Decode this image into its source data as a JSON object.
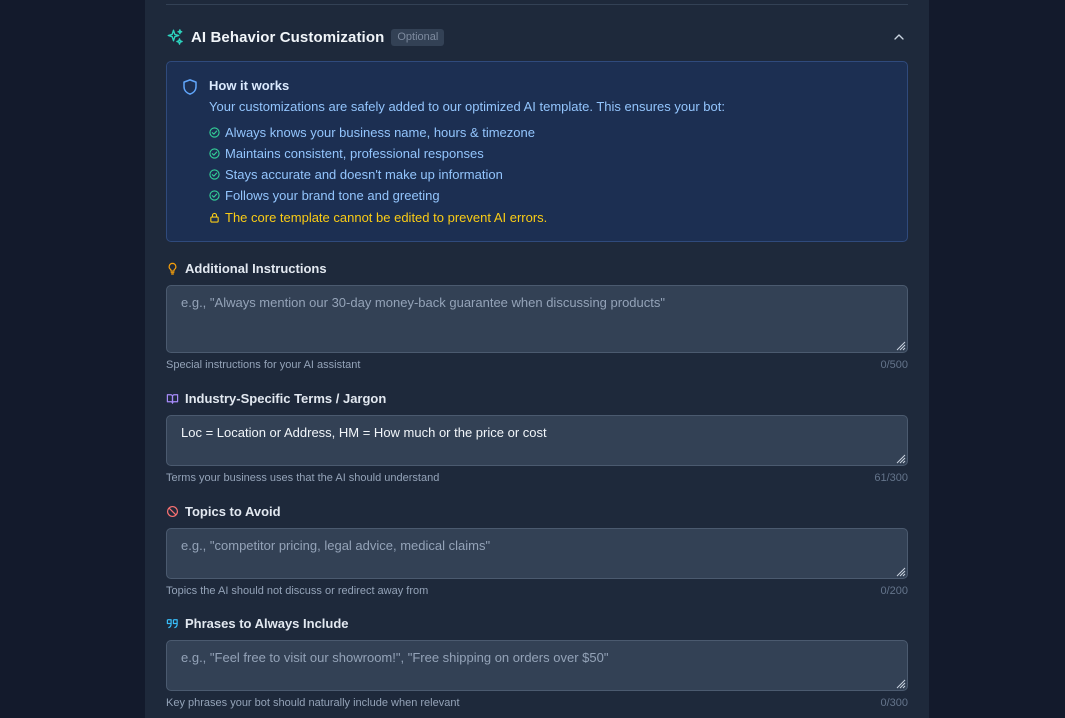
{
  "section": {
    "title": "AI Behavior Customization",
    "badge": "Optional",
    "sparkle_icon": "sparkle-icon",
    "collapse_icon": "chevron-up-icon"
  },
  "info": {
    "title": "How it works",
    "description": "Your customizations are safely added to our optimized AI template. This ensures your bot:",
    "items": [
      "Always knows your business name, hours & timezone",
      "Maintains consistent, professional responses",
      "Stays accurate and doesn't make up information",
      "Follows your brand tone and greeting"
    ],
    "warning": "The core template cannot be edited to prevent AI errors.",
    "colors": {
      "accent": "#60a5fa",
      "check": "#34d399",
      "warning": "#facc15"
    }
  },
  "fields": {
    "instructions": {
      "label": "Additional Instructions",
      "icon": "lightbulb-icon",
      "placeholder": "e.g., \"Always mention our 30-day money-back guarantee when discussing products\"",
      "value": "",
      "help": "Special instructions for your AI assistant",
      "count": "0/500"
    },
    "terms": {
      "label": "Industry-Specific Terms / Jargon",
      "icon": "book-open-icon",
      "placeholder": "",
      "value": "Loc = Location or Address, HM = How much or the price or cost",
      "help": "Terms your business uses that the AI should understand",
      "count": "61/300"
    },
    "avoid": {
      "label": "Topics to Avoid",
      "icon": "ban-icon",
      "placeholder": "e.g., \"competitor pricing, legal advice, medical claims\"",
      "value": "",
      "help": "Topics the AI should not discuss or redirect away from",
      "count": "0/200"
    },
    "phrases": {
      "label": "Phrases to Always Include",
      "icon": "quote-icon",
      "placeholder": "e.g., \"Feel free to visit our showroom!\", \"Free shipping on orders over $50\"",
      "value": "",
      "help": "Key phrases your bot should naturally include when relevant",
      "count": "0/300"
    }
  }
}
